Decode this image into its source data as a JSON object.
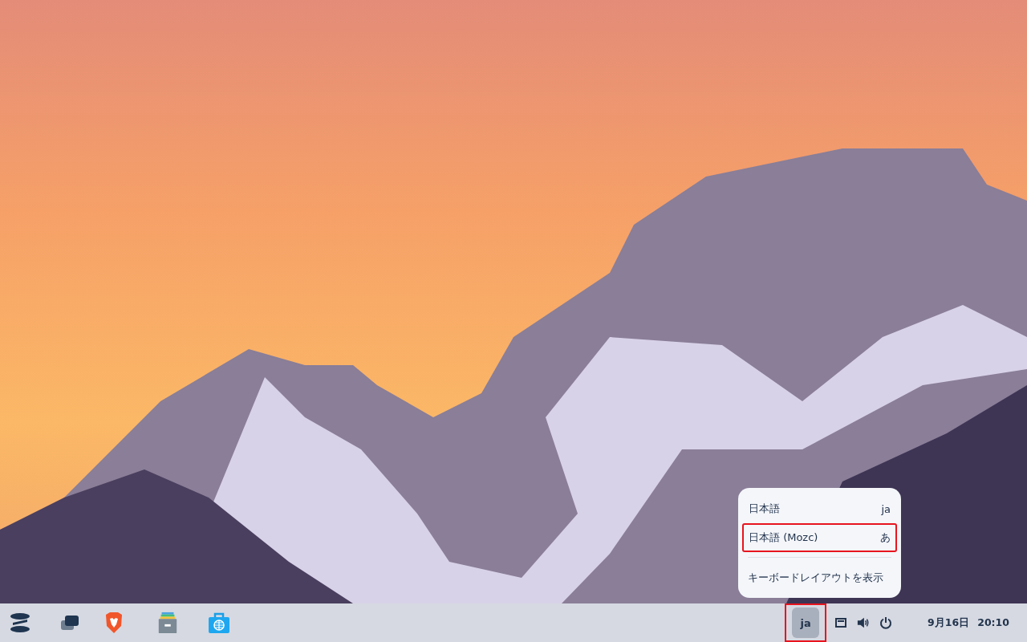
{
  "input_menu": {
    "items": [
      {
        "label": "日本語",
        "indicator": "ja",
        "highlighted": false
      },
      {
        "label": "日本語 (Mozc)",
        "indicator": "あ",
        "highlighted": true
      }
    ],
    "action": "キーボードレイアウトを表示"
  },
  "taskbar": {
    "input_indicator": {
      "label": "ja",
      "active": true,
      "highlighted": true
    },
    "date": "9月16日",
    "time": "20:10"
  }
}
